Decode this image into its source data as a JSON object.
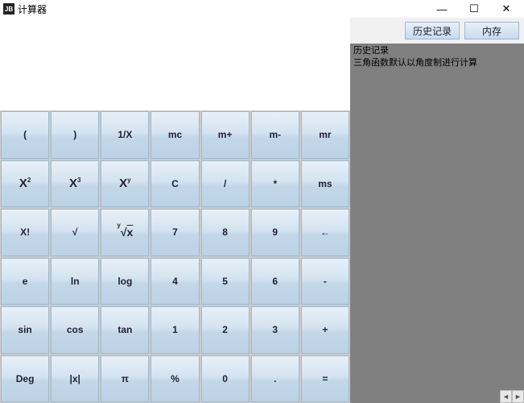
{
  "window": {
    "icon_text": "JB",
    "title": "计算器",
    "minimize": "—",
    "maximize": "☐",
    "close": "✕"
  },
  "right_tabs": {
    "history": "历史记录",
    "memory": "内存"
  },
  "history_panel": {
    "heading": "历史记录",
    "note": "三角函数默认以角度制进行计算"
  },
  "keys": {
    "r0c0": "(",
    "r0c1": ")",
    "r0c2": "1/X",
    "r0c3": "mc",
    "r0c4": "m+",
    "r0c5": "m-",
    "r0c6": "mr",
    "r1c3": "C",
    "r1c4": "/",
    "r1c5": "*",
    "r1c6": "ms",
    "r2c0": "X!",
    "r2c1": "√",
    "r2c3": "7",
    "r2c4": "8",
    "r2c5": "9",
    "r2c6": "←",
    "r3c0": "e",
    "r3c1": "ln",
    "r3c2": "log",
    "r3c3": "4",
    "r3c4": "5",
    "r3c5": "6",
    "r3c6": "-",
    "r4c0": "sin",
    "r4c1": "cos",
    "r4c2": "tan",
    "r4c3": "1",
    "r4c4": "2",
    "r4c5": "3",
    "r4c6": "+",
    "r5c0": "Deg",
    "r5c1": "|x|",
    "r5c2": "π",
    "r5c3": "%",
    "r5c4": "0",
    "r5c5": ".",
    "r5c6": "="
  },
  "scroll_arrows": {
    "left": "◄",
    "right": "►"
  }
}
